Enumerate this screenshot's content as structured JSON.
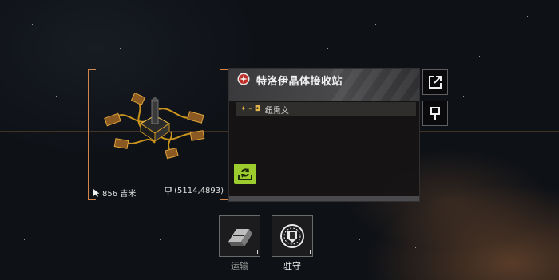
{
  "target": {
    "station_name": "特洛伊晶体接收站",
    "owner_name": "纽熏文",
    "owner_prefix_glyphs": "✦ – ◘",
    "distance_text": "856 吉米",
    "coords_text": "(5114,4893)"
  },
  "icons": {
    "faction": "faction-emblem-icon",
    "external_link": "external-link-icon",
    "pin": "map-pin-icon",
    "dock": "dock-icon",
    "transport": "transport-icon",
    "garrison": "garrison-icon",
    "cursor": "cursor-icon"
  },
  "actions": [
    {
      "label": "运输",
      "enabled": false
    },
    {
      "label": "驻守",
      "enabled": true
    }
  ],
  "colors": {
    "accent_orange": "#d4864a",
    "dock_green": "#9ccc2e",
    "owner_gold": "#e2b64a"
  }
}
